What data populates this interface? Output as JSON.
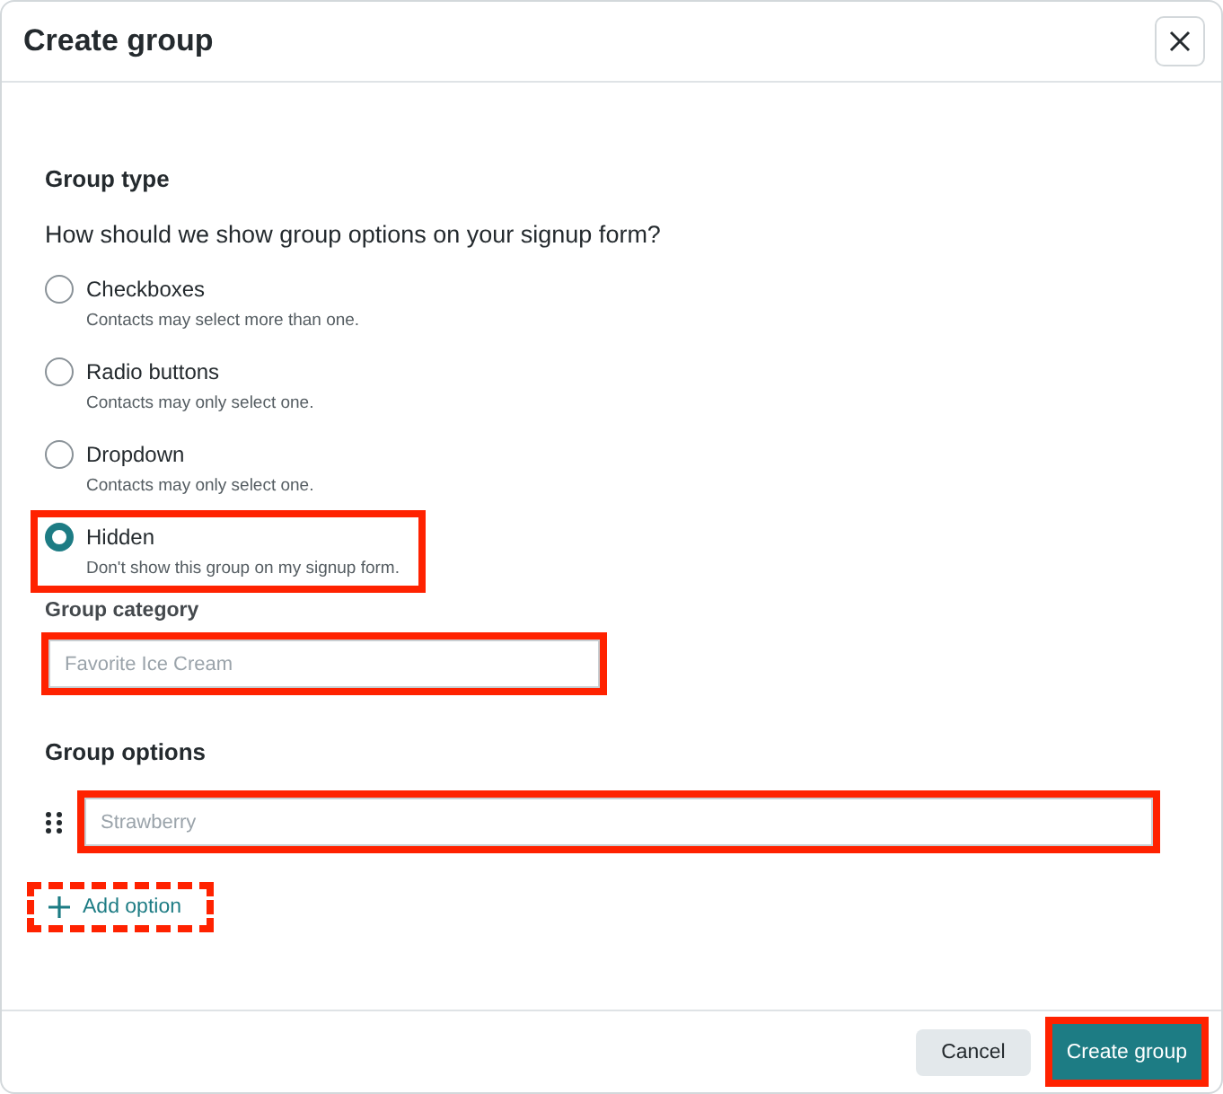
{
  "dialog": {
    "title": "Create group"
  },
  "group_type": {
    "heading": "Group type",
    "question": "How should we show group options on your signup form?",
    "options": [
      {
        "label": "Checkboxes",
        "description": "Contacts may select more than one.",
        "selected": false,
        "highlighted": false
      },
      {
        "label": "Radio buttons",
        "description": "Contacts may only select one.",
        "selected": false,
        "highlighted": false
      },
      {
        "label": "Dropdown",
        "description": "Contacts may only select one.",
        "selected": false,
        "highlighted": false
      },
      {
        "label": "Hidden",
        "description": "Don't show this group on my signup form.",
        "selected": true,
        "highlighted": true
      }
    ]
  },
  "group_category": {
    "label": "Group category",
    "placeholder": "Favorite Ice Cream",
    "highlighted": true
  },
  "group_options": {
    "heading": "Group options",
    "items": [
      {
        "placeholder": "Strawberry",
        "highlighted": true
      }
    ],
    "add_option": {
      "label": "Add option",
      "highlighted": true,
      "dashed": true
    }
  },
  "footer": {
    "buttons": [
      {
        "label": "Cancel",
        "kind": "secondary",
        "highlighted": false
      },
      {
        "label": "Create group",
        "kind": "primary",
        "highlighted": true
      }
    ]
  }
}
